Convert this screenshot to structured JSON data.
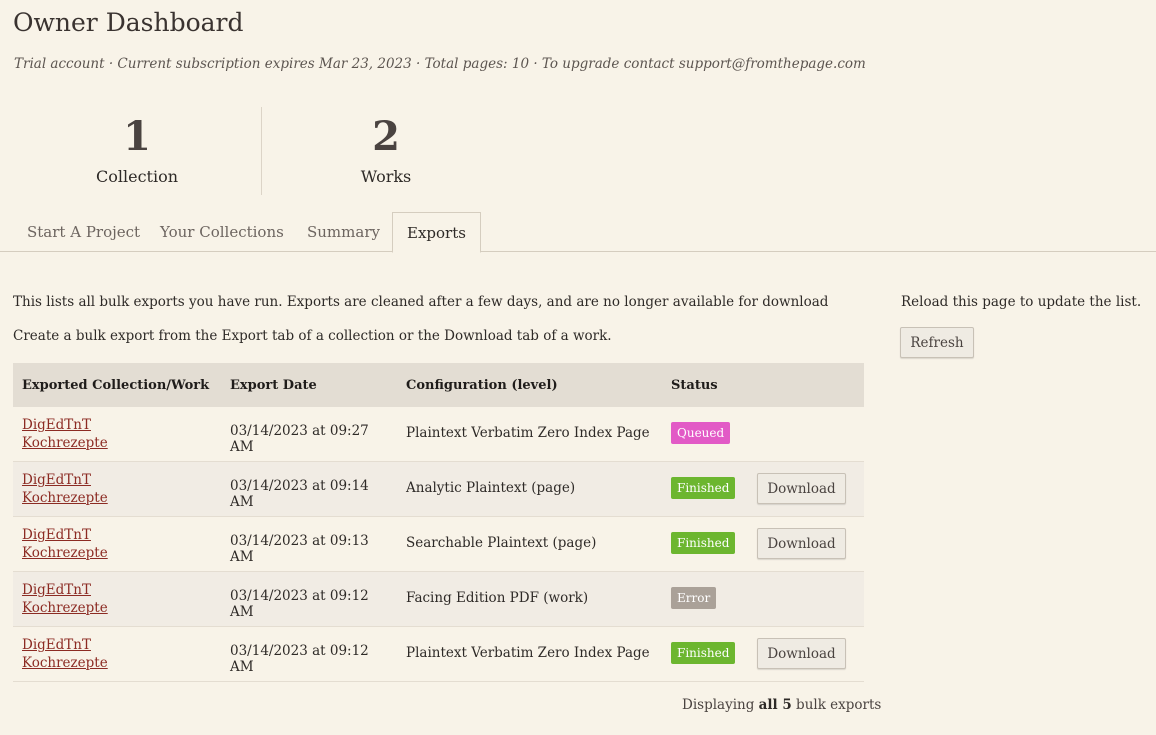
{
  "page": {
    "title": "Owner Dashboard",
    "subtitle": "Trial account · Current subscription expires Mar 23, 2023 · Total pages: 10 ·  To upgrade contact support@fromthepage.com"
  },
  "stats": [
    {
      "value": "1",
      "label": "Collection"
    },
    {
      "value": "2",
      "label": "Works"
    }
  ],
  "tabs": [
    {
      "label": "Start A Project",
      "active": false
    },
    {
      "label": "Your Collections",
      "active": false
    },
    {
      "label": "Summary",
      "active": false
    },
    {
      "label": "Exports",
      "active": true
    }
  ],
  "intro": {
    "line1": "This lists all bulk exports you have run. Exports are cleaned after a few days, and are no longer available for download",
    "line2": "Create a bulk export from the Export tab of a collection or the Download tab of a work."
  },
  "sidebar": {
    "text": "Reload this page to update the list.",
    "refresh_label": "Refresh"
  },
  "table": {
    "headers": [
      "Exported Collection/Work",
      "Export Date",
      "Configuration (level)",
      "Status"
    ],
    "rows": [
      {
        "collection": "DigEdTnT",
        "work": "Kochrezepte",
        "date": "03/14/2023 at 09:27 AM",
        "config": "Plaintext Verbatim Zero Index Page",
        "status": "Queued",
        "download": ""
      },
      {
        "collection": "DigEdTnT",
        "work": "Kochrezepte",
        "date": "03/14/2023 at 09:14 AM",
        "config": "Analytic Plaintext (page)",
        "status": "Finished",
        "download": "Download"
      },
      {
        "collection": "DigEdTnT",
        "work": "Kochrezepte",
        "date": "03/14/2023 at 09:13 AM",
        "config": "Searchable Plaintext (page)",
        "status": "Finished",
        "download": "Download"
      },
      {
        "collection": "DigEdTnT",
        "work": "Kochrezepte",
        "date": "03/14/2023 at 09:12 AM",
        "config": "Facing Edition PDF (work)",
        "status": "Error",
        "download": ""
      },
      {
        "collection": "DigEdTnT",
        "work": "Kochrezepte",
        "date": "03/14/2023 at 09:12 AM",
        "config": "Plaintext Verbatim Zero Index Page",
        "status": "Finished",
        "download": "Download"
      }
    ]
  },
  "footer": {
    "prefix": "Displaying ",
    "bold": "all 5",
    "suffix": " bulk exports"
  },
  "colors": {
    "background": "#f8f3e8",
    "link": "#8c2b23",
    "queued": "#e25ac6",
    "finished": "#6cb62f",
    "error": "#aaa198"
  }
}
